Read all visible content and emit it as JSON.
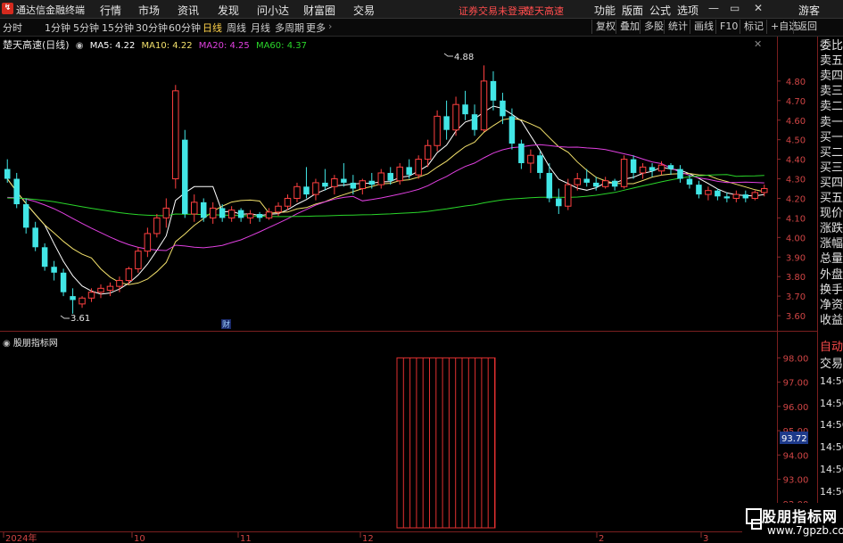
{
  "app": {
    "title": "通达信金融终端",
    "menu": [
      "行情",
      "市场",
      "资讯",
      "发现",
      "问小达",
      "财富圈",
      "交易"
    ],
    "warning": "证券交易未登录",
    "stock_link": "楚天高速",
    "right_menu": [
      "功能",
      "版面",
      "公式",
      "选项"
    ],
    "guest": "游客"
  },
  "toolbar": {
    "periods": [
      "分时",
      "1分钟",
      "5分钟",
      "15分钟",
      "30分钟",
      "60分钟",
      "日线",
      "周线",
      "月线",
      "多周期",
      "更多"
    ],
    "active_period": "日线",
    "buttons": [
      "复权",
      "叠加",
      "多股",
      "统计",
      "画线",
      "F10",
      "标记",
      "+自选",
      "返回"
    ]
  },
  "main_chart": {
    "stock_title": "楚天高速(日线)",
    "ma": [
      {
        "label": "MA5: 4.22",
        "color": "#ffffff"
      },
      {
        "label": "MA10: 4.22",
        "color": "#f2e06b"
      },
      {
        "label": "MA20: 4.25",
        "color": "#e040e0"
      },
      {
        "label": "MA60: 4.37",
        "color": "#2ad62a"
      }
    ],
    "high_label": "4.88",
    "low_label": "3.61",
    "event_marker": "财"
  },
  "sub_chart": {
    "title": "股朋指标网",
    "current_value": "93.72"
  },
  "x_axis": [
    "2024年",
    "10",
    "11",
    "12",
    "2",
    "3"
  ],
  "right_panel": [
    "委比",
    "卖五",
    "卖四",
    "卖三",
    "卖二",
    "卖一",
    "买一",
    "买二",
    "买三",
    "买四",
    "买五",
    "现价",
    "涨跌",
    "涨幅",
    "总量",
    "外盘",
    "换手",
    "净资",
    "收益",
    "自动",
    "交易",
    "14:56",
    "14:56",
    "14:56",
    "14:56",
    "14:56",
    "14:56",
    "14:56",
    "14:56"
  ],
  "watermark": {
    "line1": "股朋指标网",
    "line2": "www.7gpzb.com"
  },
  "chart_data": [
    {
      "type": "candlestick",
      "title": "楚天高速(日线)",
      "ylim": [
        3.55,
        4.95
      ],
      "yticks": [
        3.6,
        3.7,
        3.8,
        3.9,
        4.0,
        4.1,
        4.2,
        4.3,
        4.4,
        4.5,
        4.6,
        4.7,
        4.8
      ],
      "ohlc": [
        [
          4.35,
          4.4,
          4.28,
          4.3
        ],
        [
          4.3,
          4.33,
          4.15,
          4.17
        ],
        [
          4.17,
          4.2,
          4.02,
          4.05
        ],
        [
          4.05,
          4.08,
          3.93,
          3.95
        ],
        [
          3.95,
          3.97,
          3.83,
          3.85
        ],
        [
          3.85,
          3.88,
          3.78,
          3.82
        ],
        [
          3.82,
          3.84,
          3.7,
          3.72
        ],
        [
          3.7,
          3.74,
          3.61,
          3.68
        ],
        [
          3.66,
          3.7,
          3.64,
          3.69
        ],
        [
          3.69,
          3.74,
          3.67,
          3.72
        ],
        [
          3.72,
          3.76,
          3.69,
          3.74
        ],
        [
          3.73,
          3.77,
          3.7,
          3.75
        ],
        [
          3.75,
          3.8,
          3.72,
          3.78
        ],
        [
          3.78,
          3.85,
          3.76,
          3.84
        ],
        [
          3.84,
          3.95,
          3.82,
          3.93
        ],
        [
          3.93,
          4.05,
          3.9,
          4.02
        ],
        [
          4.02,
          4.12,
          4.0,
          4.1
        ],
        [
          4.1,
          4.2,
          4.05,
          4.15
        ],
        [
          4.3,
          4.78,
          4.25,
          4.75
        ],
        [
          4.5,
          4.55,
          4.1,
          4.12
        ],
        [
          4.12,
          4.22,
          4.08,
          4.18
        ],
        [
          4.18,
          4.2,
          4.08,
          4.1
        ],
        [
          4.1,
          4.18,
          4.07,
          4.15
        ],
        [
          4.15,
          4.17,
          4.08,
          4.1
        ],
        [
          4.1,
          4.16,
          4.08,
          4.14
        ],
        [
          4.14,
          4.15,
          4.08,
          4.1
        ],
        [
          4.1,
          4.14,
          4.07,
          4.12
        ],
        [
          4.12,
          4.13,
          4.08,
          4.1
        ],
        [
          4.1,
          4.15,
          4.09,
          4.13
        ],
        [
          4.13,
          4.18,
          4.11,
          4.16
        ],
        [
          4.16,
          4.22,
          4.14,
          4.2
        ],
        [
          4.2,
          4.28,
          4.18,
          4.26
        ],
        [
          4.26,
          4.36,
          4.2,
          4.22
        ],
        [
          4.22,
          4.3,
          4.19,
          4.28
        ],
        [
          4.28,
          4.35,
          4.24,
          4.26
        ],
        [
          4.26,
          4.32,
          4.22,
          4.3
        ],
        [
          4.3,
          4.38,
          4.26,
          4.28
        ],
        [
          4.28,
          4.32,
          4.22,
          4.25
        ],
        [
          4.25,
          4.3,
          4.22,
          4.29
        ],
        [
          4.29,
          4.33,
          4.25,
          4.27
        ],
        [
          4.27,
          4.35,
          4.25,
          4.33
        ],
        [
          4.33,
          4.36,
          4.27,
          4.29
        ],
        [
          4.29,
          4.38,
          4.27,
          4.36
        ],
        [
          4.36,
          4.4,
          4.3,
          4.32
        ],
        [
          4.32,
          4.42,
          4.3,
          4.4
        ],
        [
          4.4,
          4.5,
          4.36,
          4.47
        ],
        [
          4.47,
          4.65,
          4.44,
          4.62
        ],
        [
          4.62,
          4.7,
          4.5,
          4.55
        ],
        [
          4.55,
          4.72,
          4.52,
          4.68
        ],
        [
          4.68,
          4.75,
          4.6,
          4.63
        ],
        [
          4.63,
          4.68,
          4.52,
          4.55
        ],
        [
          4.55,
          4.88,
          4.54,
          4.8
        ],
        [
          4.8,
          4.85,
          4.65,
          4.7
        ],
        [
          4.7,
          4.74,
          4.58,
          4.62
        ],
        [
          4.62,
          4.66,
          4.45,
          4.48
        ],
        [
          4.48,
          4.5,
          4.35,
          4.38
        ],
        [
          4.38,
          4.45,
          4.33,
          4.42
        ],
        [
          4.42,
          4.44,
          4.3,
          4.33
        ],
        [
          4.33,
          4.38,
          4.18,
          4.2
        ],
        [
          4.2,
          4.25,
          4.12,
          4.16
        ],
        [
          4.16,
          4.3,
          4.14,
          4.27
        ],
        [
          4.27,
          4.33,
          4.24,
          4.3
        ],
        [
          4.3,
          4.35,
          4.26,
          4.28
        ],
        [
          4.28,
          4.31,
          4.24,
          4.26
        ],
        [
          4.26,
          4.31,
          4.25,
          4.29
        ],
        [
          4.29,
          4.3,
          4.24,
          4.26
        ],
        [
          4.26,
          4.42,
          4.25,
          4.4
        ],
        [
          4.4,
          4.42,
          4.3,
          4.33
        ],
        [
          4.33,
          4.38,
          4.3,
          4.36
        ],
        [
          4.36,
          4.38,
          4.31,
          4.34
        ],
        [
          4.34,
          4.39,
          4.32,
          4.37
        ],
        [
          4.37,
          4.38,
          4.32,
          4.35
        ],
        [
          4.35,
          4.37,
          4.28,
          4.3
        ],
        [
          4.3,
          4.32,
          4.25,
          4.27
        ],
        [
          4.27,
          4.29,
          4.2,
          4.22
        ],
        [
          4.22,
          4.26,
          4.19,
          4.24
        ],
        [
          4.24,
          4.25,
          4.19,
          4.21
        ],
        [
          4.21,
          4.23,
          4.18,
          4.2
        ],
        [
          4.2,
          4.24,
          4.18,
          4.22
        ],
        [
          4.22,
          4.24,
          4.18,
          4.2
        ],
        [
          4.2,
          4.24,
          4.19,
          4.23
        ],
        [
          4.23,
          4.27,
          4.21,
          4.25
        ]
      ],
      "ma_values": {
        "MA5": 4.22,
        "MA10": 4.22,
        "MA20": 4.25,
        "MA60": 4.37
      }
    },
    {
      "type": "bar",
      "title": "股朋指标网",
      "ylim": [
        91.0,
        98.6
      ],
      "yticks": [
        92.0,
        93.0,
        94.0,
        95.0,
        96.0,
        97.0,
        98.0
      ],
      "bar_range_top": 98.0,
      "current_value": 93.72
    }
  ]
}
